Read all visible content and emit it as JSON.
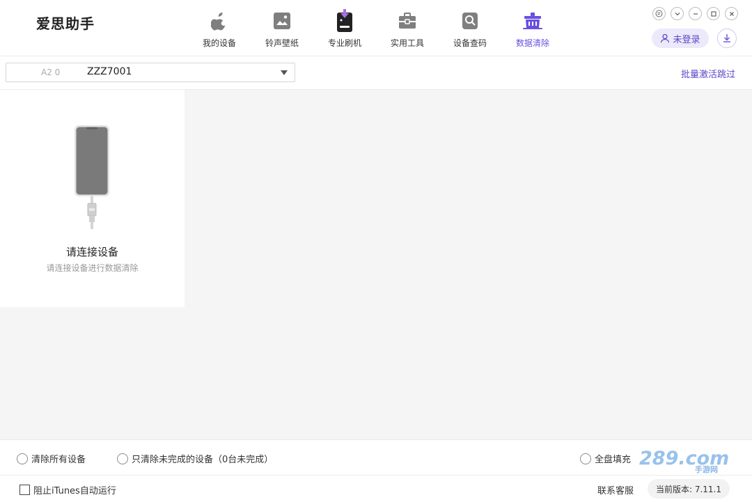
{
  "app": {
    "logo_text": "爱思助手"
  },
  "nav": {
    "items": [
      {
        "label": "我的设备",
        "icon": "apple-icon"
      },
      {
        "label": "铃声壁纸",
        "icon": "image-icon"
      },
      {
        "label": "专业刷机",
        "icon": "flash-device-icon"
      },
      {
        "label": "实用工具",
        "icon": "toolbox-icon"
      },
      {
        "label": "设备查码",
        "icon": "search-device-icon"
      },
      {
        "label": "数据清除",
        "icon": "erase-data-icon",
        "active": true
      }
    ]
  },
  "window": {
    "controls": [
      "feedback-icon",
      "dropdown-icon",
      "minimize-icon",
      "maximize-icon",
      "close-icon"
    ]
  },
  "account": {
    "login_label": "未登录"
  },
  "device_bar": {
    "select_prefix": "A2 0",
    "select_value": "ZZZ7001",
    "batch_link": "批量激活跳过"
  },
  "device_card": {
    "title": "请连接设备",
    "subtitle": "请连接设备进行数据清除"
  },
  "options": {
    "clear_all": "清除所有设备",
    "clear_unfinished": "只清除未完成的设备（0台未完成）",
    "full_fill": "全盘填充"
  },
  "watermark": {
    "text": "289.com",
    "sub": "手游网"
  },
  "footer": {
    "block_itunes": "阻止iTunes自动运行",
    "contact": "联系客服",
    "version": "当前版本: 7.11.1"
  },
  "colors": {
    "accent": "#6a4fe0",
    "nav_icon": "#7f7f7f"
  }
}
